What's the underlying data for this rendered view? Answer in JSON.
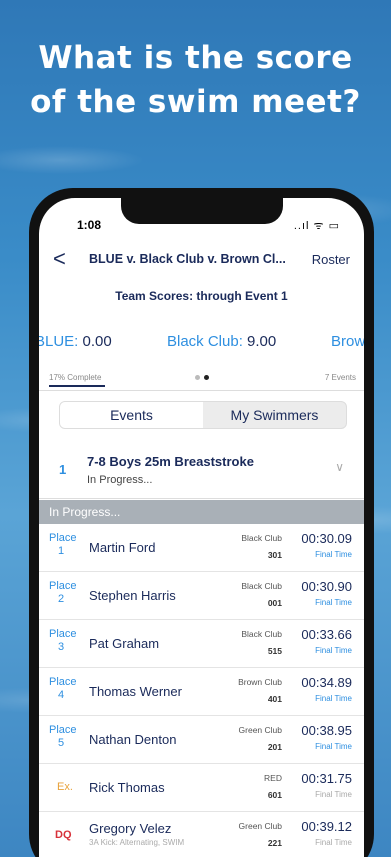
{
  "headline": {
    "line1": "What is the score",
    "line2": "of the swim meet?"
  },
  "status_bar": {
    "time": "1:08",
    "icons": "..ıl ᯤ ▭"
  },
  "nav": {
    "back": "<",
    "title": "BLUE v. Black Club v. Brown Cl...",
    "roster": "Roster"
  },
  "team_scores": {
    "title": "Team Scores: through Event 1",
    "teams": [
      {
        "label": "BLUE:",
        "value": "0.00"
      },
      {
        "label": "Black Club:",
        "value": "9.00"
      },
      {
        "label": "Brow",
        "value": ""
      }
    ]
  },
  "progress": {
    "left": "17% Complete",
    "right": "7 Events"
  },
  "tabs": [
    "Events",
    "My Swimmers"
  ],
  "event": {
    "number": "1",
    "name": "7-8 Boys 25m Breaststroke",
    "status": "In Progress...",
    "chevron": "∨"
  },
  "section": "In Progress...",
  "results": [
    {
      "place_word": "Place",
      "place": "1",
      "name": "Martin Ford",
      "club": "Black Club",
      "num": "301",
      "time": "00:30.09",
      "note": "Final Time"
    },
    {
      "place_word": "Place",
      "place": "2",
      "name": "Stephen Harris",
      "club": "Black Club",
      "num": "001",
      "time": "00:30.90",
      "note": "Final Time"
    },
    {
      "place_word": "Place",
      "place": "3",
      "name": "Pat Graham",
      "club": "Black Club",
      "num": "515",
      "time": "00:33.66",
      "note": "Final Time"
    },
    {
      "place_word": "Place",
      "place": "4",
      "name": "Thomas Werner",
      "club": "Brown Club",
      "num": "401",
      "time": "00:34.89",
      "note": "Final Time"
    },
    {
      "place_word": "Place",
      "place": "5",
      "name": "Nathan Denton",
      "club": "Green Club",
      "num": "201",
      "time": "00:38.95",
      "note": "Final Time"
    },
    {
      "place_word": "Ex.",
      "place": "",
      "name": "Rick Thomas",
      "club": "RED",
      "num": "601",
      "time": "00:31.75",
      "note": "Final Time"
    },
    {
      "place_word": "DQ",
      "place": "",
      "name": "Gregory Velez",
      "sub": "3A Kick: Alternating, SWIM",
      "club": "Green Club",
      "num": "221",
      "time": "00:39.12",
      "note": "Final Time"
    }
  ],
  "colors": {
    "accent": "#2e8fe0",
    "navy": "#1a2a5a",
    "ex": "#e8a23a",
    "dq": "#d8323a"
  }
}
